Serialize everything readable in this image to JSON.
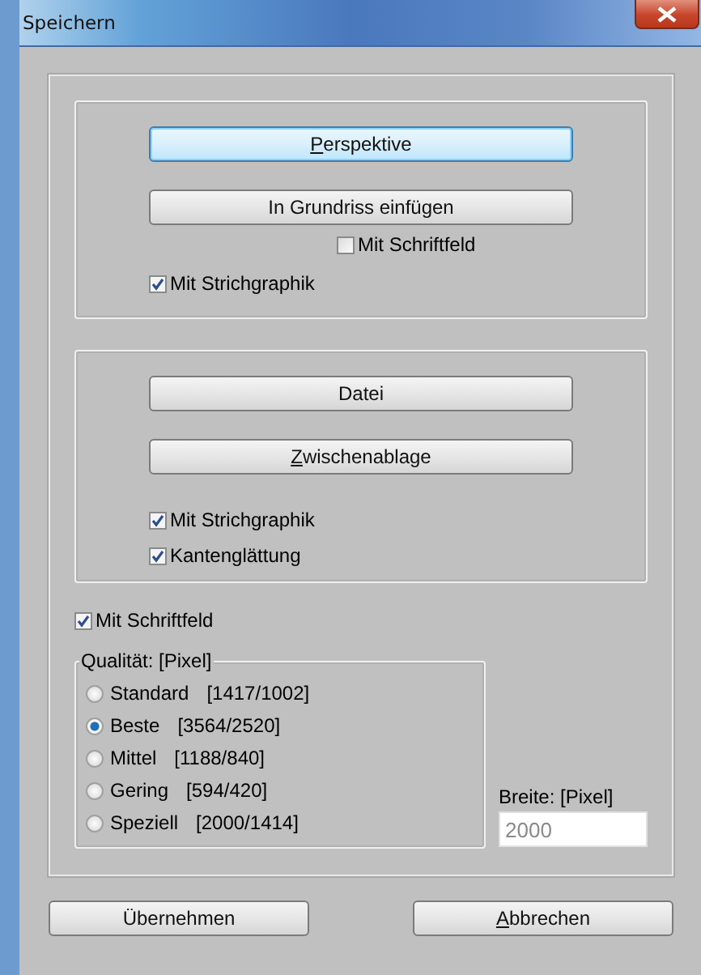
{
  "window": {
    "title": "Speichern"
  },
  "panel_1": {
    "buttons": [
      {
        "label": "Perspektive",
        "focused": true,
        "underline_first": true
      },
      {
        "label": "In Grundriss einfügen",
        "focused": false,
        "underline_first": false
      }
    ],
    "checkboxes": [
      {
        "label": "Mit Schriftfeld",
        "checked": false
      },
      {
        "label": "Mit Strichgraphik",
        "checked": true
      }
    ]
  },
  "panel_2": {
    "buttons": [
      {
        "label": "Datei",
        "focused": false,
        "underline_first": false
      },
      {
        "label": "Zwischenablage",
        "focused": false,
        "underline_first": true
      }
    ],
    "checkboxes": [
      {
        "label": "Mit Strichgraphik",
        "checked": true
      },
      {
        "label": "Kantenglättung",
        "checked": true
      }
    ]
  },
  "title_block_checkbox": {
    "label": "Mit Schriftfeld",
    "checked": true
  },
  "quality": {
    "legend": "Qualität: [Pixel]",
    "options": [
      {
        "label": "Standard",
        "size": "[1417/1002]",
        "selected": false
      },
      {
        "label": "Beste",
        "size": "[3564/2520]",
        "selected": true
      },
      {
        "label": "Mittel",
        "size": "[1188/840]",
        "selected": false
      },
      {
        "label": "Gering",
        "size": "[594/420]",
        "selected": false
      },
      {
        "label": "Speziell",
        "size": "[2000/1414]",
        "selected": false
      }
    ]
  },
  "width_field": {
    "label": "Breite: [Pixel]",
    "value": "2000",
    "disabled": true
  },
  "footer_buttons": [
    {
      "label": "Übernehmen",
      "underline_first": false
    },
    {
      "label": "Abbrechen",
      "underline_first": true
    }
  ]
}
